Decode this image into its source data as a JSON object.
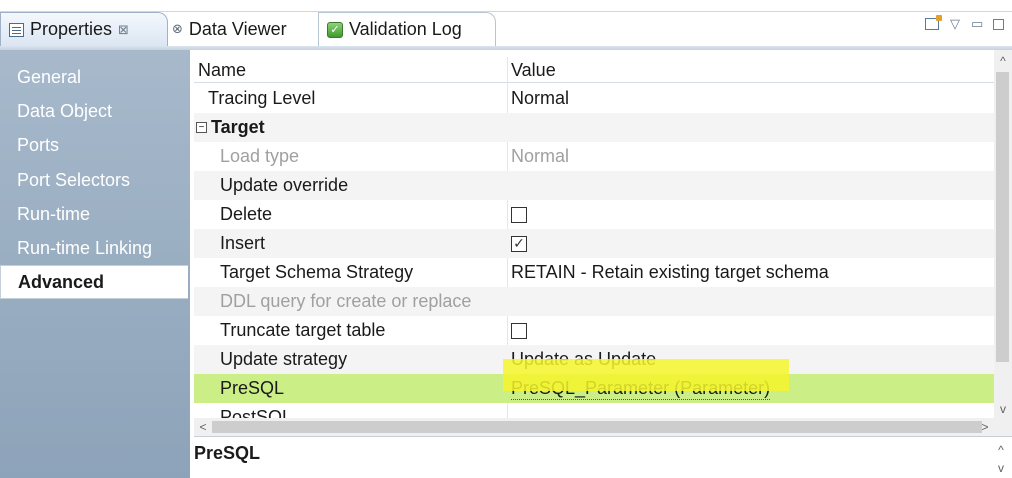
{
  "tabs": [
    {
      "label": "Properties",
      "close": "⊠",
      "icon": "properties-icon",
      "active": true
    },
    {
      "label": "Data Viewer",
      "icon": "data-viewer-icon"
    },
    {
      "label": "Validation Log",
      "icon": "validation-log-icon"
    }
  ],
  "window_controls": {
    "menu": "▽",
    "minimize": "▭"
  },
  "sidebar": {
    "items": [
      {
        "label": "General"
      },
      {
        "label": "Data Object"
      },
      {
        "label": "Ports"
      },
      {
        "label": "Port Selectors"
      },
      {
        "label": "Run-time"
      },
      {
        "label": "Run-time Linking"
      },
      {
        "label": "Advanced",
        "active": true
      }
    ]
  },
  "grid": {
    "columns": {
      "name": "Name",
      "value": "Value"
    },
    "rows": [
      {
        "name": "Tracing Level",
        "value": "Normal"
      },
      {
        "name": "Target",
        "group": true,
        "expander": "−"
      },
      {
        "name": "Load type",
        "value": "Normal",
        "disabled": true
      },
      {
        "name": "Update override",
        "value": ""
      },
      {
        "name": "Delete",
        "checkbox": false
      },
      {
        "name": "Insert",
        "checkbox": true
      },
      {
        "name": "Target Schema Strategy",
        "value": "RETAIN - Retain existing target schema"
      },
      {
        "name": "DDL query for create or replace",
        "value": "",
        "disabled": true
      },
      {
        "name": "Truncate target table",
        "checkbox": false
      },
      {
        "name": "Update strategy",
        "value": "Update as Update"
      },
      {
        "name": "PreSQL",
        "value": "PreSQL_Parameter (Parameter)",
        "selected": true
      },
      {
        "name": "PostSQL",
        "value": ""
      }
    ],
    "checked_glyph": "✓"
  },
  "scrollbars": {
    "up": "^",
    "down": "v",
    "left": "<",
    "right": ">"
  },
  "description": {
    "title": "PreSQL"
  },
  "colors": {
    "sidebar": "#9fb2c6",
    "selected_row": "#cbef86",
    "highlight": "#f6f42a"
  }
}
